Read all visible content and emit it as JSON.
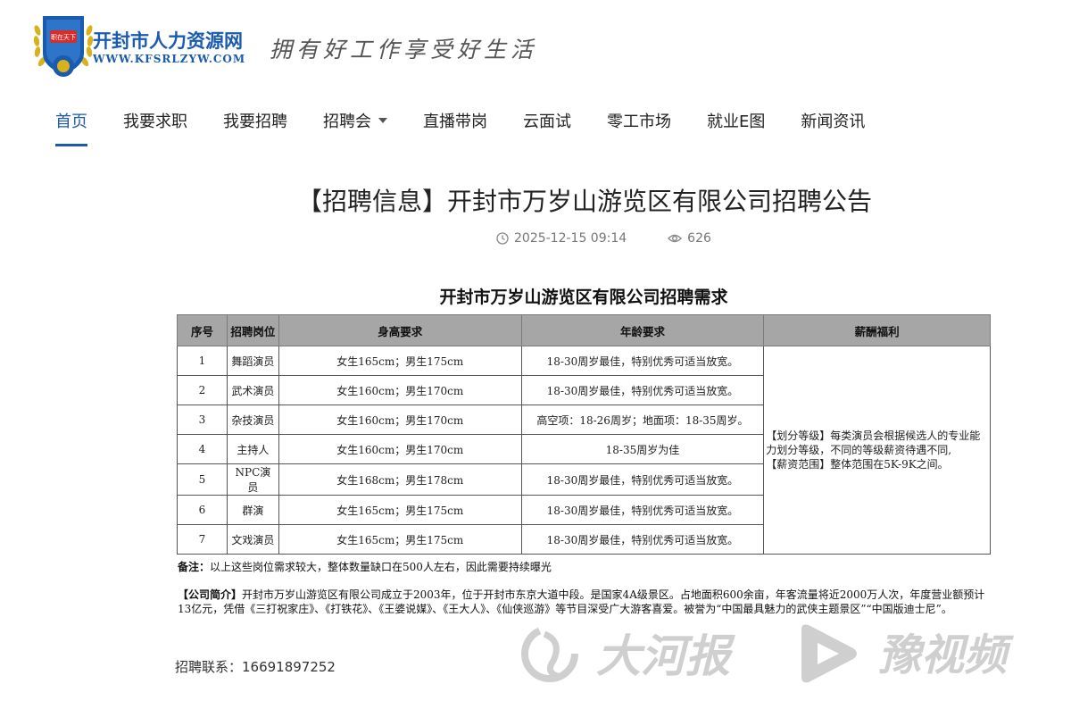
{
  "site": {
    "name": "开封市人力资源网",
    "url": "WWW.KFSRLZYW.COM",
    "slogan": "拥有好工作享受好生活",
    "logo_badge": "职在天下"
  },
  "nav": {
    "items": [
      {
        "label": "首页",
        "active": true
      },
      {
        "label": "我要求职"
      },
      {
        "label": "我要招聘"
      },
      {
        "label": "招聘会",
        "dropdown": true
      },
      {
        "label": "直播带岗"
      },
      {
        "label": "云面试"
      },
      {
        "label": "零工市场"
      },
      {
        "label": "就业E图"
      },
      {
        "label": "新闻资讯"
      }
    ]
  },
  "article": {
    "title": "【招聘信息】开封市万岁山游览区有限公司招聘公告",
    "datetime": "2025-12-15 09:14",
    "views": "626"
  },
  "table": {
    "title": "开封市万岁山游览区有限公司招聘需求",
    "headers": [
      "序号",
      "招聘岗位",
      "身高要求",
      "年龄要求",
      "薪酬福利"
    ],
    "rows": [
      {
        "no": "1",
        "position": "舞蹈演员",
        "height": "女生165cm；男生175cm",
        "age": "18-30周岁最佳，特别优秀可适当放宽。"
      },
      {
        "no": "2",
        "position": "武术演员",
        "height": "女生160cm；男生170cm",
        "age": "18-30周岁最佳，特别优秀可适当放宽。"
      },
      {
        "no": "3",
        "position": "杂技演员",
        "height": "女生160cm；男生170cm",
        "age": "高空项：18-26周岁；地面项：18-35周岁。"
      },
      {
        "no": "4",
        "position": "主持人",
        "height": "女生160cm；男生170cm",
        "age": "18-35周岁为佳"
      },
      {
        "no": "5",
        "position": "NPC演员",
        "height": "女生168cm；男生178cm",
        "age": "18-30周岁最佳，特别优秀可适当放宽。"
      },
      {
        "no": "6",
        "position": "群演",
        "height": "女生165cm；男生175cm",
        "age": "18-30周岁最佳，特别优秀可适当放宽。"
      },
      {
        "no": "7",
        "position": "文戏演员",
        "height": "女生165cm；男生175cm",
        "age": "18-30周岁最佳，特别优秀可适当放宽。"
      }
    ],
    "benefit_line1": "【划分等级】每类演员会根据候选人的专业能力划分等级，不同的等级薪资待遇不同,",
    "benefit_line2": "【薪资范围】整体范围在5K-9K之间。"
  },
  "note": {
    "label": "备注：",
    "text": "以上这些岗位需求较大，整体数量缺口在500人左右，因此需要持续曝光"
  },
  "intro": {
    "label": "【公司简介】",
    "text": "开封市万岁山游览区有限公司成立于2003年，位于开封市东京大道中段。是国家4A级景区。占地面积600余亩，年客流量将近2000万人次，年度营业额预计13亿元，凭借《三打祝家庄》、《打铁花》、《王婆说媒》、《王大人》、《仙侠巡游》等节目深受广大游客喜爱。被誉为“中国最具魅力的武侠主题景区”“中国版迪士尼”。"
  },
  "contact": "招聘联系：16691897252",
  "watermarks": {
    "left": "大河报",
    "right": "豫视频"
  },
  "colors": {
    "brand": "#1a5bb0",
    "header_bg": "#a6a6a6"
  }
}
